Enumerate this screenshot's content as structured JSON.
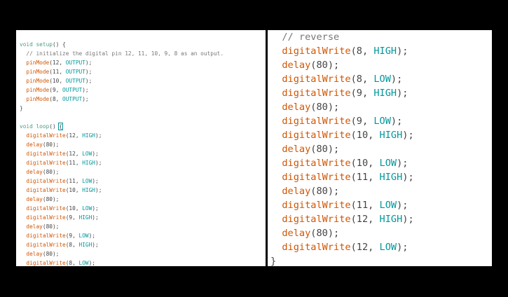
{
  "colors": {
    "keyword": "#4a9c7e",
    "function": "#d35400",
    "constant": "#00979c",
    "comment": "#777777",
    "text": "#444444",
    "background": "#ffffff",
    "frame": "#000000"
  },
  "left_code": [
    [
      {
        "t": "void",
        "c": "kw"
      },
      {
        "t": " "
      },
      {
        "t": "setup",
        "c": "kw"
      },
      {
        "t": "() {"
      }
    ],
    [
      {
        "t": "  // initialize the digital pin 12, 11, 10, 9, 8 as an output.",
        "c": "cm"
      }
    ],
    [
      {
        "t": "  "
      },
      {
        "t": "pinMode",
        "c": "fn"
      },
      {
        "t": "(12, "
      },
      {
        "t": "OUTPUT",
        "c": "cst"
      },
      {
        "t": ");"
      }
    ],
    [
      {
        "t": "  "
      },
      {
        "t": "pinMode",
        "c": "fn"
      },
      {
        "t": "(11, "
      },
      {
        "t": "OUTPUT",
        "c": "cst"
      },
      {
        "t": ");"
      }
    ],
    [
      {
        "t": "  "
      },
      {
        "t": "pinMode",
        "c": "fn"
      },
      {
        "t": "(10, "
      },
      {
        "t": "OUTPUT",
        "c": "cst"
      },
      {
        "t": ");"
      }
    ],
    [
      {
        "t": "  "
      },
      {
        "t": "pinMode",
        "c": "fn"
      },
      {
        "t": "(9, "
      },
      {
        "t": "OUTPUT",
        "c": "cst"
      },
      {
        "t": ");"
      }
    ],
    [
      {
        "t": "  "
      },
      {
        "t": "pinMode",
        "c": "fn"
      },
      {
        "t": "(8, "
      },
      {
        "t": "OUTPUT",
        "c": "cst"
      },
      {
        "t": ");"
      }
    ],
    [
      {
        "t": "}"
      }
    ],
    [],
    [
      {
        "t": "void",
        "c": "kw"
      },
      {
        "t": " "
      },
      {
        "t": "loop",
        "c": "kw"
      },
      {
        "t": "() "
      },
      {
        "t": "{",
        "c": "caret"
      }
    ],
    [
      {
        "t": "  "
      },
      {
        "t": "digitalWrite",
        "c": "fn"
      },
      {
        "t": "(12, "
      },
      {
        "t": "HIGH",
        "c": "cst"
      },
      {
        "t": ");"
      }
    ],
    [
      {
        "t": "  "
      },
      {
        "t": "delay",
        "c": "fn"
      },
      {
        "t": "(80);"
      }
    ],
    [
      {
        "t": "  "
      },
      {
        "t": "digitalWrite",
        "c": "fn"
      },
      {
        "t": "(12, "
      },
      {
        "t": "LOW",
        "c": "cst"
      },
      {
        "t": ");"
      }
    ],
    [
      {
        "t": "  "
      },
      {
        "t": "digitalWrite",
        "c": "fn"
      },
      {
        "t": "(11, "
      },
      {
        "t": "HIGH",
        "c": "cst"
      },
      {
        "t": ");"
      }
    ],
    [
      {
        "t": "  "
      },
      {
        "t": "delay",
        "c": "fn"
      },
      {
        "t": "(80);"
      }
    ],
    [
      {
        "t": "  "
      },
      {
        "t": "digitalWrite",
        "c": "fn"
      },
      {
        "t": "(11, "
      },
      {
        "t": "LOW",
        "c": "cst"
      },
      {
        "t": ");"
      }
    ],
    [
      {
        "t": "  "
      },
      {
        "t": "digitalWrite",
        "c": "fn"
      },
      {
        "t": "(10, "
      },
      {
        "t": "HIGH",
        "c": "cst"
      },
      {
        "t": ");"
      }
    ],
    [
      {
        "t": "  "
      },
      {
        "t": "delay",
        "c": "fn"
      },
      {
        "t": "(80);"
      }
    ],
    [
      {
        "t": "  "
      },
      {
        "t": "digitalWrite",
        "c": "fn"
      },
      {
        "t": "(10, "
      },
      {
        "t": "LOW",
        "c": "cst"
      },
      {
        "t": ");"
      }
    ],
    [
      {
        "t": "  "
      },
      {
        "t": "digitalWrite",
        "c": "fn"
      },
      {
        "t": "(9, "
      },
      {
        "t": "HIGH",
        "c": "cst"
      },
      {
        "t": ");"
      }
    ],
    [
      {
        "t": "  "
      },
      {
        "t": "delay",
        "c": "fn"
      },
      {
        "t": "(80);"
      }
    ],
    [
      {
        "t": "  "
      },
      {
        "t": "digitalWrite",
        "c": "fn"
      },
      {
        "t": "(9, "
      },
      {
        "t": "LOW",
        "c": "cst"
      },
      {
        "t": ");"
      }
    ],
    [
      {
        "t": "  "
      },
      {
        "t": "digitalWrite",
        "c": "fn"
      },
      {
        "t": "(8, "
      },
      {
        "t": "HIGH",
        "c": "cst"
      },
      {
        "t": ");"
      }
    ],
    [
      {
        "t": "  "
      },
      {
        "t": "delay",
        "c": "fn"
      },
      {
        "t": "(80);"
      }
    ],
    [
      {
        "t": "  "
      },
      {
        "t": "digitalWrite",
        "c": "fn"
      },
      {
        "t": "(8, "
      },
      {
        "t": "LOW",
        "c": "cst"
      },
      {
        "t": ");"
      }
    ]
  ],
  "right_code": [
    [
      {
        "t": "  // reverse",
        "c": "cm"
      }
    ],
    [
      {
        "t": "  "
      },
      {
        "t": "digitalWrite",
        "c": "fn"
      },
      {
        "t": "(8, "
      },
      {
        "t": "HIGH",
        "c": "cst"
      },
      {
        "t": ");"
      }
    ],
    [
      {
        "t": "  "
      },
      {
        "t": "delay",
        "c": "fn"
      },
      {
        "t": "(80);"
      }
    ],
    [
      {
        "t": "  "
      },
      {
        "t": "digitalWrite",
        "c": "fn"
      },
      {
        "t": "(8, "
      },
      {
        "t": "LOW",
        "c": "cst"
      },
      {
        "t": ");"
      }
    ],
    [
      {
        "t": "  "
      },
      {
        "t": "digitalWrite",
        "c": "fn"
      },
      {
        "t": "(9, "
      },
      {
        "t": "HIGH",
        "c": "cst"
      },
      {
        "t": ");"
      }
    ],
    [
      {
        "t": "  "
      },
      {
        "t": "delay",
        "c": "fn"
      },
      {
        "t": "(80);"
      }
    ],
    [
      {
        "t": "  "
      },
      {
        "t": "digitalWrite",
        "c": "fn"
      },
      {
        "t": "(9, "
      },
      {
        "t": "LOW",
        "c": "cst"
      },
      {
        "t": ");"
      }
    ],
    [
      {
        "t": "  "
      },
      {
        "t": "digitalWrite",
        "c": "fn"
      },
      {
        "t": "(10, "
      },
      {
        "t": "HIGH",
        "c": "cst"
      },
      {
        "t": ");"
      }
    ],
    [
      {
        "t": "  "
      },
      {
        "t": "delay",
        "c": "fn"
      },
      {
        "t": "(80);"
      }
    ],
    [
      {
        "t": "  "
      },
      {
        "t": "digitalWrite",
        "c": "fn"
      },
      {
        "t": "(10, "
      },
      {
        "t": "LOW",
        "c": "cst"
      },
      {
        "t": ");"
      }
    ],
    [
      {
        "t": "  "
      },
      {
        "t": "digitalWrite",
        "c": "fn"
      },
      {
        "t": "(11, "
      },
      {
        "t": "HIGH",
        "c": "cst"
      },
      {
        "t": ");"
      }
    ],
    [
      {
        "t": "  "
      },
      {
        "t": "delay",
        "c": "fn"
      },
      {
        "t": "(80);"
      }
    ],
    [
      {
        "t": "  "
      },
      {
        "t": "digitalWrite",
        "c": "fn"
      },
      {
        "t": "(11, "
      },
      {
        "t": "LOW",
        "c": "cst"
      },
      {
        "t": ");"
      }
    ],
    [
      {
        "t": "  "
      },
      {
        "t": "digitalWrite",
        "c": "fn"
      },
      {
        "t": "(12, "
      },
      {
        "t": "HIGH",
        "c": "cst"
      },
      {
        "t": ");"
      }
    ],
    [
      {
        "t": "  "
      },
      {
        "t": "delay",
        "c": "fn"
      },
      {
        "t": "(80);"
      }
    ],
    [
      {
        "t": "  "
      },
      {
        "t": "digitalWrite",
        "c": "fn"
      },
      {
        "t": "(12, "
      },
      {
        "t": "LOW",
        "c": "cst"
      },
      {
        "t": ");"
      }
    ],
    [
      {
        "t": "}"
      }
    ]
  ]
}
